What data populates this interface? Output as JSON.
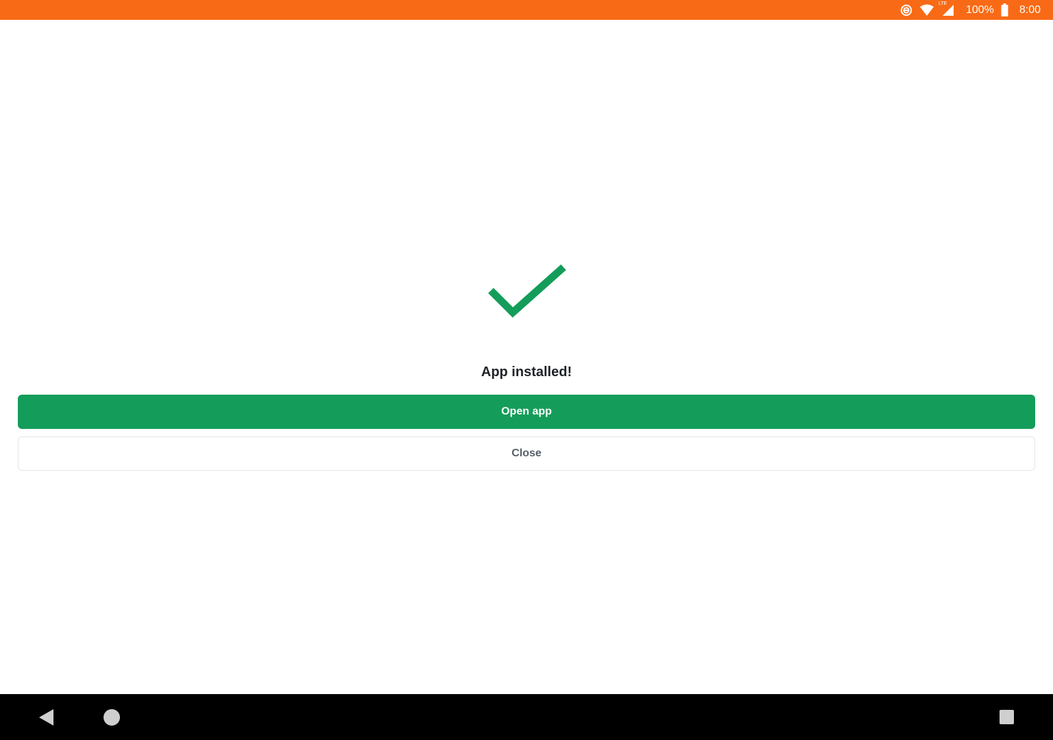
{
  "status_bar": {
    "background_color": "#f96a16",
    "icons": [
      "data-saver-icon",
      "wifi-icon",
      "lte-signal-icon",
      "battery-icon"
    ],
    "lte_label": "LTE",
    "battery_percent": "100%",
    "time": "8:00"
  },
  "main": {
    "success_icon": "checkmark-icon",
    "success_color": "#149d5a",
    "title": "App installed!",
    "open_button_label": "Open app",
    "close_button_label": "Close"
  },
  "nav_bar": {
    "icons": [
      "back-icon",
      "home-icon",
      "recents-icon"
    ]
  }
}
